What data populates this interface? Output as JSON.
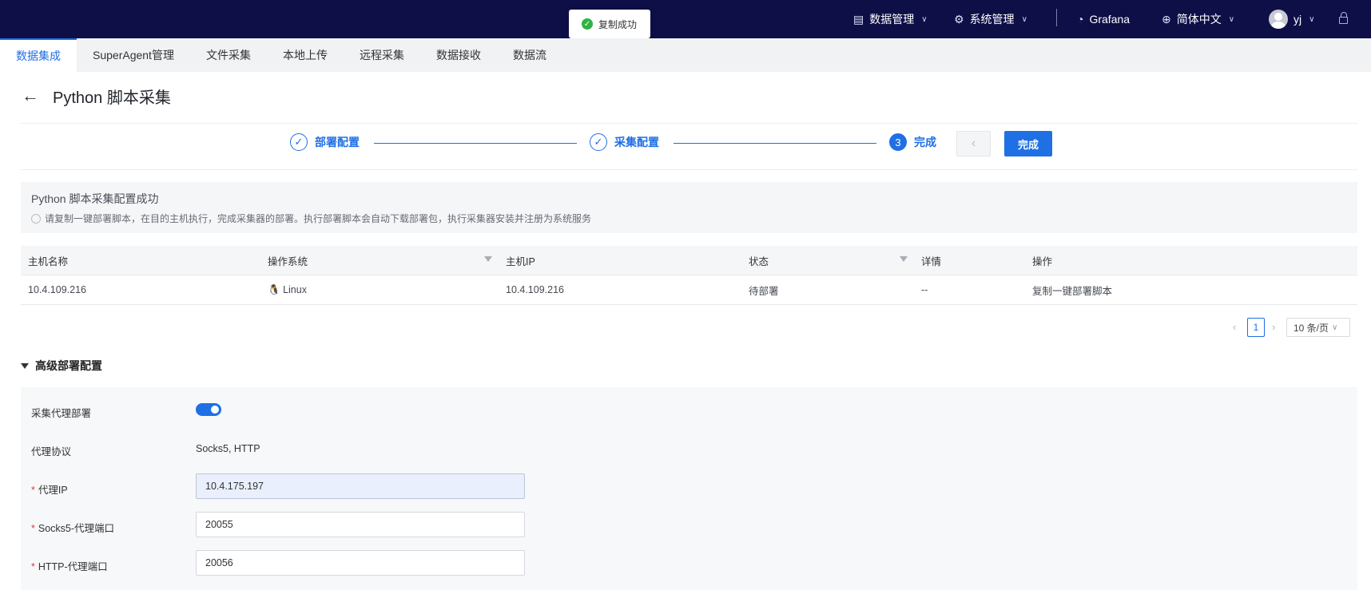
{
  "toast": {
    "message": "复制成功"
  },
  "topnav": {
    "data_mgmt": "数据管理",
    "sys_mgmt": "系统管理",
    "grafana": "Grafana",
    "language": "简体中文",
    "user": "yj"
  },
  "tabs": [
    "数据集成",
    "SuperAgent管理",
    "文件采集",
    "本地上传",
    "远程采集",
    "数据接收",
    "数据流"
  ],
  "page": {
    "title": "Python 脚本采集"
  },
  "steps": [
    {
      "label": "部署配置",
      "state": "done"
    },
    {
      "label": "采集配置",
      "state": "done"
    },
    {
      "label": "完成",
      "number": "3",
      "state": "current"
    }
  ],
  "buttons": {
    "prev": "‹",
    "done": "完成"
  },
  "banner": {
    "heading": "Python 脚本采集配置成功",
    "desc": "请复制一键部署脚本，在目的主机执行，完成采集器的部署。执行部署脚本会自动下载部署包，执行采集器安装并注册为系统服务"
  },
  "table": {
    "columns": [
      "主机名称",
      "操作系统",
      "主机IP",
      "状态",
      "详情",
      "操作"
    ],
    "rows": [
      {
        "host": "10.4.109.216",
        "os": "Linux",
        "ip": "10.4.109.216",
        "status": "待部署",
        "detail": "--",
        "action": "复制一键部署脚本"
      }
    ]
  },
  "pagination": {
    "current": "1",
    "page_size": "10 条/页"
  },
  "advanced": {
    "title": "高级部署配置",
    "fields": [
      {
        "label": "采集代理部署",
        "type": "toggle",
        "value": true
      },
      {
        "label": "代理协议",
        "type": "text",
        "value": "Socks5, HTTP"
      },
      {
        "label": "代理IP",
        "type": "input",
        "value": "10.4.175.197",
        "required": true
      },
      {
        "label": "Socks5-代理端口",
        "type": "input",
        "value": "20055",
        "required": true
      },
      {
        "label": "HTTP-代理端口",
        "type": "input",
        "value": "20056",
        "required": true
      }
    ]
  },
  "colors": {
    "topbar": "#0e0f47",
    "accent": "#1f6fe5",
    "success": "#2fb344",
    "required": "#e03b3b"
  }
}
